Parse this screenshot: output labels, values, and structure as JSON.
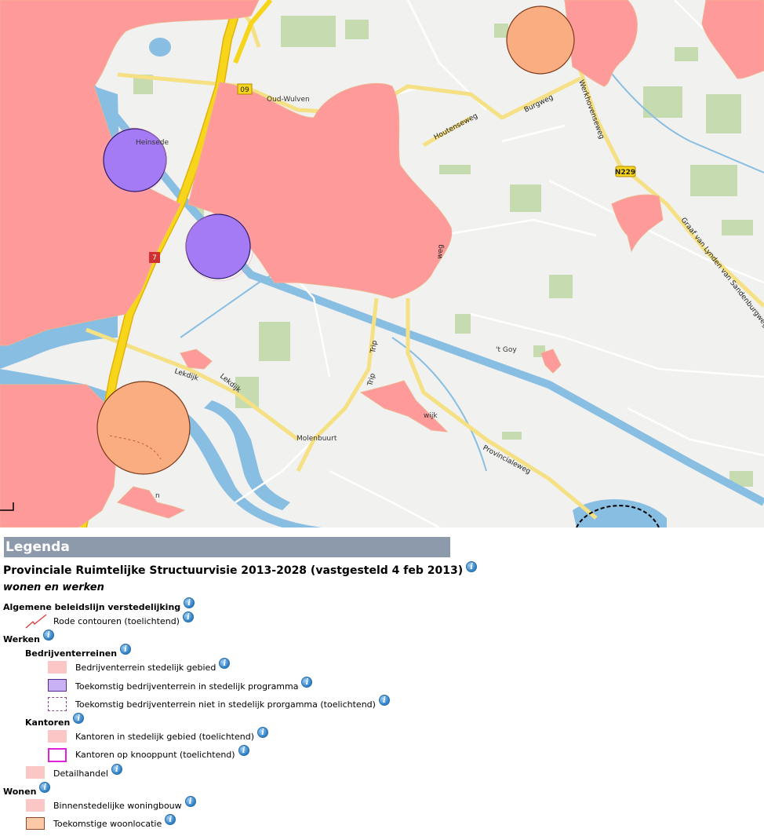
{
  "map": {
    "place_labels": {
      "oud_wulven": "Oud-Wulven",
      "heinsede": "Heinsede",
      "goy": "'t Goy",
      "molenbuurt": "Molenbuurt",
      "wijk": "wijk",
      "n": "n"
    },
    "road_labels": {
      "houtenseweg": "Houtenseweg",
      "burgweg": "Burgweg",
      "werkhovenseweg": "Werkhovenseweg",
      "n229": "N229",
      "graaf": "Graaf van Lynden van Sandenburgweg",
      "lekdijk1": "Lekdijk",
      "lekdijk2": "Lekdijk",
      "trip1": "Trip",
      "trip2": "Trip",
      "provincialeweg": "Provincialeweg",
      "a27_shield": "7",
      "small_shield": "09",
      "wadd": "weg"
    },
    "colors": {
      "background": "#f1f1ef",
      "red_contour": "#fe9a9a",
      "purple": "#a57af5",
      "orange": "#f9ad80",
      "water": "#89bee3",
      "highway": "#f7d51a",
      "major_road": "#f7e99c",
      "green": "#c6dcb0"
    }
  },
  "legend": {
    "header": "Legenda",
    "title": "Provinciale Ruimtelijke Structuurvisie 2013-2028 (vastgesteld 4 feb 2013)",
    "subtitle": "wonen en werken",
    "items": {
      "algemene": "Algemene beleidslijn verstedelijking",
      "rode_contouren": "Rode contouren (toelichtend)",
      "werken": "Werken",
      "bedrijventerreinen": "Bedrijventerreinen",
      "bedrijf_stedelijk": "Bedrijventerrein stedelijk gebied",
      "toekomstig_in": "Toekomstig bedrijventerrein in stedelijk programma",
      "toekomstig_niet": "Toekomstig bedrijventerrein niet in stedelijk prorgamma (toelichtend)",
      "kantoren": "Kantoren",
      "kantoren_stedelijk": "Kantoren in stedelijk gebied (toelichtend)",
      "kantoren_knooppunt": "Kantoren op knooppunt (toelichtend)",
      "detailhandel": "Detailhandel",
      "wonen": "Wonen",
      "binnenstedelijke": "Binnenstedelijke woningbouw",
      "toekomstige_woon": "Toekomstige woonlocatie"
    },
    "info_glyph": "i",
    "swatch_colors": {
      "light_red": "#fcc6c6",
      "purple_fill": "#c8b2f5",
      "purple_border": "#5a2a8a",
      "dashed_border": "#8a4a8a",
      "magenta": "#e020e0",
      "orange_fill": "#fbc8a8",
      "orange_border": "#8a4a2a",
      "contour_line": "#e03030"
    }
  }
}
